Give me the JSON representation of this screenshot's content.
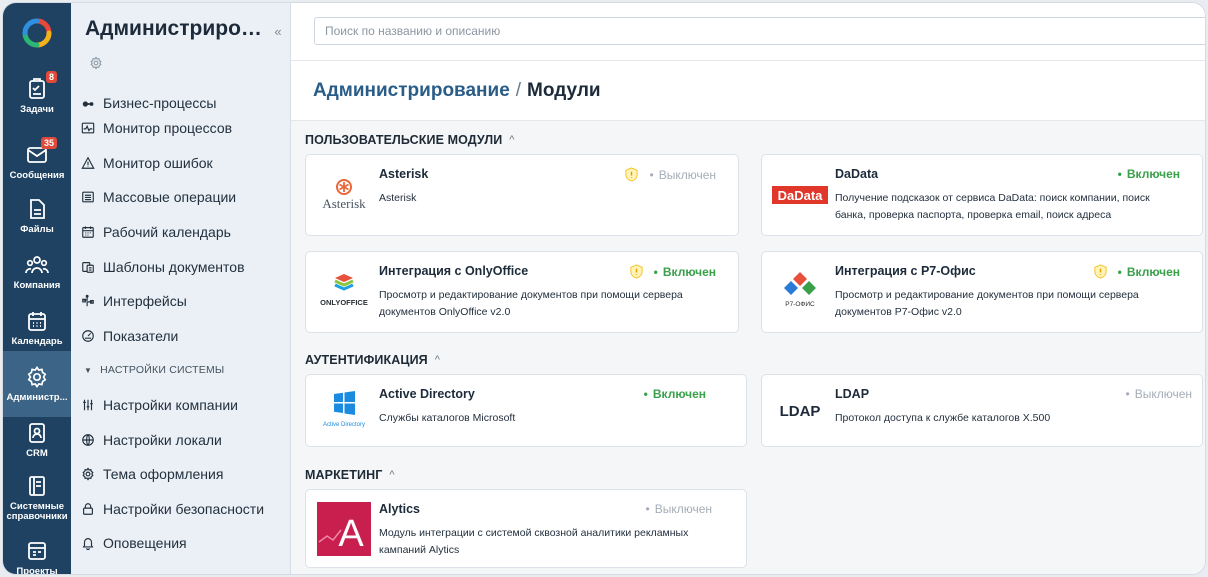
{
  "rail": {
    "items": [
      {
        "label": "Задачи",
        "badge": "8",
        "icon": "tasks-icon"
      },
      {
        "label": "Сообщения",
        "badge": "35",
        "icon": "messages-icon"
      },
      {
        "label": "Файлы",
        "badge": "",
        "icon": "files-icon"
      },
      {
        "label": "Компания",
        "badge": "",
        "icon": "company-icon"
      },
      {
        "label": "Календарь",
        "badge": "",
        "icon": "calendar-icon"
      },
      {
        "label": "Администр...",
        "badge": "",
        "icon": "gear-icon"
      },
      {
        "label": "CRM",
        "badge": "",
        "icon": "crm-icon"
      },
      {
        "label": "Системные справочники",
        "badge": "",
        "icon": "directory-icon"
      },
      {
        "label": "Проекты",
        "badge": "",
        "icon": "projects-icon"
      }
    ]
  },
  "sidebar": {
    "title": "Администрирование",
    "collapse_label": "«",
    "items": [
      {
        "label": "Бизнес-процессы",
        "icon": "workflow-icon"
      },
      {
        "label": "Монитор процессов",
        "icon": "process-monitor-icon"
      },
      {
        "label": "Монитор ошибок",
        "icon": "warning-icon"
      },
      {
        "label": "Массовые операции",
        "icon": "list-icon"
      },
      {
        "label": "Рабочий календарь",
        "icon": "calendar-icon"
      },
      {
        "label": "Шаблоны документов",
        "icon": "document-template-icon"
      },
      {
        "label": "Интерфейсы",
        "icon": "interface-icon"
      },
      {
        "label": "Показатели",
        "icon": "gauge-icon"
      }
    ],
    "section_system": "НАСТРОЙКИ СИСТЕМЫ",
    "system_items": [
      {
        "label": "Настройки компании",
        "icon": "sliders-icon"
      },
      {
        "label": "Настройки локали",
        "icon": "globe-icon"
      },
      {
        "label": "Тема оформления",
        "icon": "gear-icon"
      },
      {
        "label": "Настройки безопасности",
        "icon": "lock-icon"
      },
      {
        "label": "Оповещения",
        "icon": "bell-icon"
      }
    ]
  },
  "search": {
    "placeholder": "Поиск по названию и описанию",
    "value": ""
  },
  "breadcrumb": {
    "parent": "Администрирование",
    "separator": "/",
    "current": "Модули"
  },
  "sections": {
    "custom": "ПОЛЬЗОВАТЕЛЬСКИЕ МОДУЛИ",
    "auth": "АУТЕНТИФИКАЦИЯ",
    "marketing": "МАРКЕТИНГ"
  },
  "status_dot": "•",
  "modules": {
    "asterisk": {
      "title": "Asterisk",
      "desc": "Asterisk",
      "status": "Выключен",
      "logo_text": "Asterisk"
    },
    "dadata": {
      "title": "DaData",
      "desc": "Получение подсказок от сервиса DaData: поиск компании, поиск банка, проверка паспорта, проверка email, поиск адреса",
      "status": "Включен",
      "logo_text": "DaData"
    },
    "onlyoffice": {
      "title": "Интеграция с OnlyOffice",
      "desc": "Просмотр и редактирование документов при помощи сервера документов OnlyOffice v2.0",
      "status": "Включен",
      "logo_text": "ONLYOFFICE"
    },
    "r7": {
      "title": "Интеграция с Р7-Офис",
      "desc": "Просмотр и редактирование документов при помощи сервера документов Р7-Офис v2.0",
      "status": "Включен",
      "logo_text": "Р7-ОФИС"
    },
    "ad": {
      "title": "Active Directory",
      "desc": "Службы каталогов Microsoft",
      "status": "Включен",
      "logo_text": "Active Directory"
    },
    "ldap": {
      "title": "LDAP",
      "desc": "Протокол доступа к службе каталогов X.500",
      "status": "Выключен",
      "logo_text": "LDAP"
    },
    "alytics": {
      "title": "Alytics",
      "desc": "Модуль интеграции с системой сквозной аналитики рекламных кампаний Alytics",
      "status": "Выключен",
      "logo_text": "A"
    }
  },
  "colors": {
    "rail_bg": "#1f4262",
    "rail_active": "#3b6486",
    "link": "#2a5c88",
    "status_on": "#3aa04a",
    "status_off": "#a4adb7",
    "badge": "#e04a3a",
    "dadata_red": "#e1372b"
  }
}
